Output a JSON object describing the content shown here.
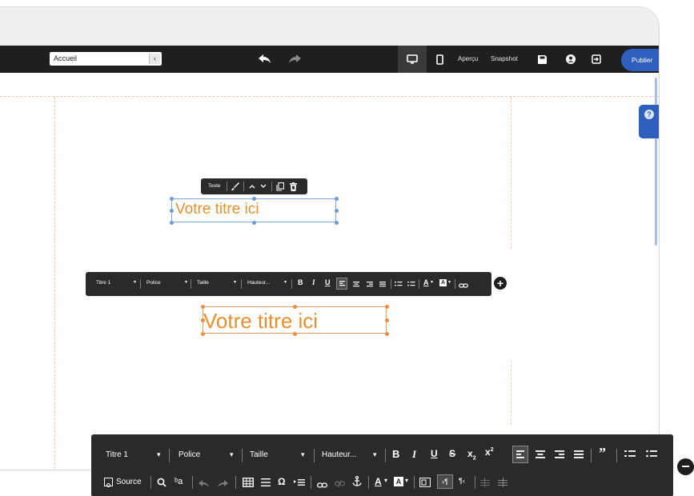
{
  "topbar": {
    "page_select_value": "Accueil",
    "preview_label": "Aperçu",
    "snapshot_label": "Snapshot",
    "publish_label": "Publier"
  },
  "help_label": "?",
  "element_toolbar": {
    "type_label": "Texte"
  },
  "canvas": {
    "title_1": "Votre titre ici",
    "title_2": "Votre titre ici"
  },
  "format_toolbar_small": {
    "style_value": "Titre 1",
    "font_value": "Police",
    "size_value": "Taille",
    "height_value": "Hauteur..."
  },
  "format_toolbar_large": {
    "style_value": "Titre 1",
    "font_value": "Police",
    "size_value": "Taille",
    "height_value": "Hauteur...",
    "source_label": "Source"
  },
  "colors": {
    "accent": "#2f5fbe",
    "title_text": "#e8902c",
    "toolbar_bg": "#2a2a2a",
    "selection_blue": "#7fa7dc",
    "selection_orange": "#ef9a5a"
  }
}
